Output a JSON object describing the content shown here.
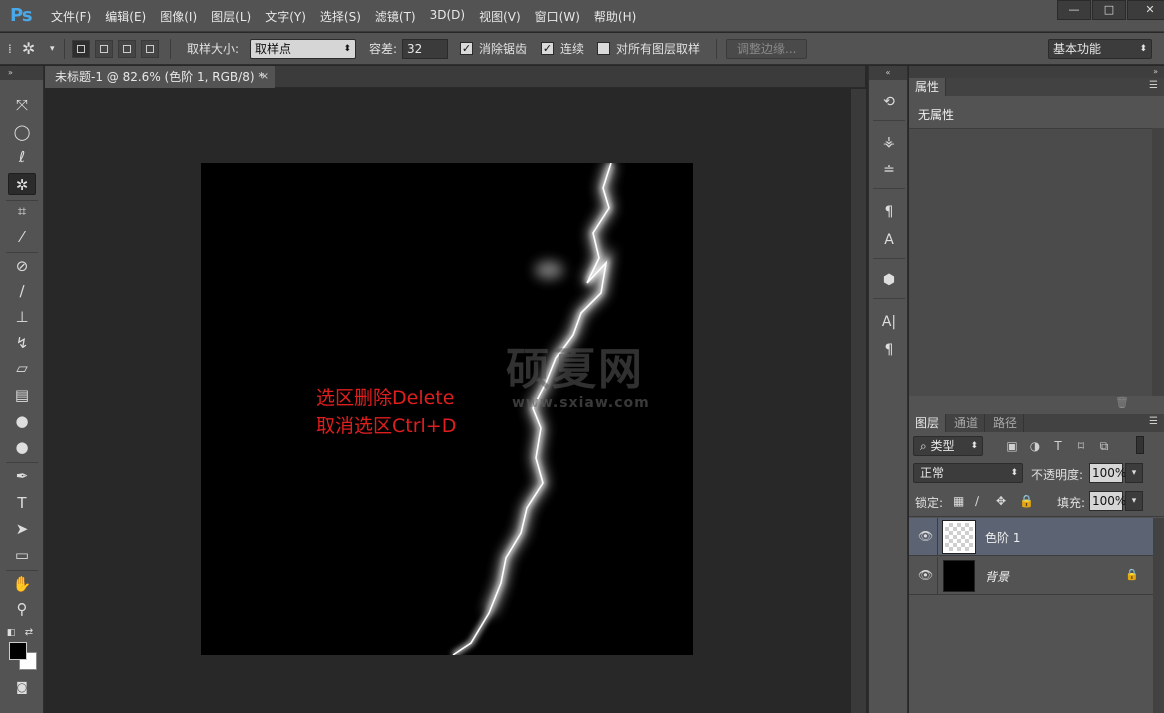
{
  "app": {
    "logo": "Ps"
  },
  "menu": [
    "文件(F)",
    "编辑(E)",
    "图像(I)",
    "图层(L)",
    "文字(Y)",
    "选择(S)",
    "滤镜(T)",
    "3D(D)",
    "视图(V)",
    "窗口(W)",
    "帮助(H)"
  ],
  "window_controls": {
    "minimize": "—",
    "maximize": "□",
    "close": "✕"
  },
  "options": {
    "tool_icon": "magic-wand-icon",
    "sample_size_label": "取样大小:",
    "sample_size_value": "取样点",
    "tolerance_label": "容差:",
    "tolerance_value": "32",
    "antialias_label": "消除锯齿",
    "antialias_checked": true,
    "contiguous_label": "连续",
    "contiguous_checked": true,
    "all_layers_label": "对所有图层取样",
    "all_layers_checked": false,
    "refine_edge_label": "调整边缘...",
    "workspace_value": "基本功能"
  },
  "document": {
    "tab_title": "未标题-1 @ 82.6% (色阶 1, RGB/8) *",
    "close_glyph": "×"
  },
  "canvas": {
    "hint_line1": "选区删除Delete",
    "hint_line2": "取消选区Ctrl+D",
    "hint_color": "#e01e1e",
    "watermark_main": "硕夏网",
    "watermark_url": "www.sxiaw.com"
  },
  "tools": [
    "move-icon",
    "marquee-icon",
    "lasso-icon",
    "magic-wand-icon",
    "crop-icon",
    "eyedropper-icon",
    "healing-brush-icon",
    "brush-icon",
    "clone-stamp-icon",
    "history-brush-icon",
    "eraser-icon",
    "gradient-icon",
    "blur-icon",
    "dodge-icon",
    "pen-icon",
    "type-icon",
    "path-selection-icon",
    "rectangle-icon",
    "hand-icon",
    "zoom-icon"
  ],
  "colors": {
    "foreground": "#000000",
    "background": "#ffffff"
  },
  "properties_panel": {
    "tab": "属性",
    "content": "无属性"
  },
  "layers_panel": {
    "tabs": [
      "图层",
      "通道",
      "路径"
    ],
    "filter_label": "类型",
    "blend_mode": "正常",
    "opacity_label": "不透明度:",
    "opacity_value": "100%",
    "lock_label": "锁定:",
    "fill_label": "填充:",
    "fill_value": "100%",
    "layers": [
      {
        "name": "色阶 1",
        "selected": true,
        "thumb": "transparent",
        "locked": false
      },
      {
        "name": "背景",
        "selected": false,
        "thumb": "black",
        "locked": true
      }
    ]
  }
}
